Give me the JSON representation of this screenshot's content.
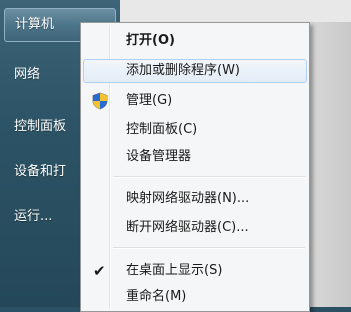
{
  "start_menu": {
    "items": [
      {
        "label": "计算机",
        "highlight": true
      },
      {
        "label": "网络"
      },
      {
        "label": "控制面板"
      },
      {
        "label": "设备和打"
      },
      {
        "label": "运行..."
      }
    ]
  },
  "context_menu": {
    "items": [
      {
        "label": "打开(O)"
      },
      {
        "label": "添加或删除程序(W)"
      },
      {
        "label": "管理(G)",
        "icon": "uac-shield-icon"
      },
      {
        "label": "控制面板(C)"
      },
      {
        "label": "设备管理器"
      },
      {
        "label": "映射网络驱动器(N)..."
      },
      {
        "label": "断开网络驱动器(C)..."
      },
      {
        "label": "在桌面上显示(S)",
        "checked": true
      },
      {
        "label": "重命名(M)"
      }
    ]
  }
}
